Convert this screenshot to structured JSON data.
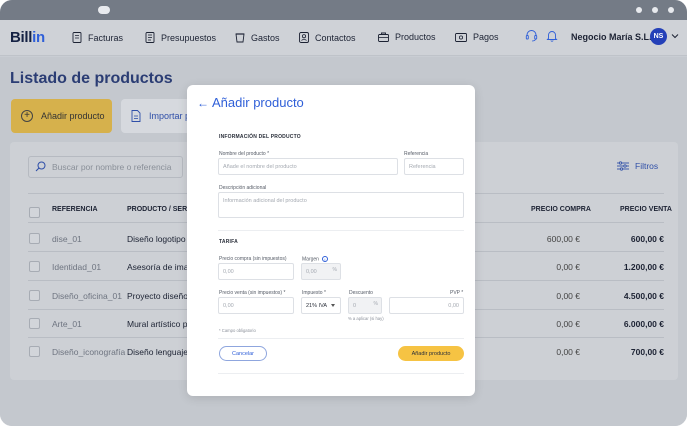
{
  "app": {
    "logo_text": "Bill",
    "logo_accent": "in",
    "brand_color": "#2f5fd8"
  },
  "nav": {
    "items": [
      {
        "label": "Facturas",
        "icon": "invoice-icon"
      },
      {
        "label": "Presupuestos",
        "icon": "quote-icon"
      },
      {
        "label": "Gastos",
        "icon": "expenses-icon"
      },
      {
        "label": "Contactos",
        "icon": "contacts-icon"
      },
      {
        "label": "Productos",
        "icon": "products-icon"
      },
      {
        "label": "Pagos",
        "icon": "payments-icon"
      }
    ],
    "company": "Negocio María S.L.",
    "avatar_initials": "NS"
  },
  "page": {
    "title": "Listado de productos",
    "add_button": "Añadir producto",
    "import_button": "Importar p",
    "search_placeholder": "Buscar por nombre o referencia",
    "filters_label": "Filtros"
  },
  "table": {
    "headers": {
      "reference": "REFERENCIA",
      "product": "PRODUCTO / SERVIC",
      "purchase_price": "PRECIO COMPRA",
      "sale_price": "PRECIO VENTA"
    },
    "rows": [
      {
        "reference": "dise_01",
        "product": "Diseño logotipo",
        "purchase": "600,00 €",
        "sale": "600,00 €"
      },
      {
        "reference": "Identidad_01",
        "product": "Asesoría de imag",
        "purchase": "0,00 €",
        "sale": "1.200,00 €"
      },
      {
        "reference": "Diseño_oficina_01",
        "product": "Proyecto diseño",
        "purchase": "0,00 €",
        "sale": "4.500,00 €"
      },
      {
        "reference": "Arte_01",
        "product": "Mural artístico pe",
        "purchase": "0,00 €",
        "sale": "6.000,00 €"
      },
      {
        "reference": "Diseño_iconografía",
        "product": "Diseño lenguaje i",
        "purchase": "0,00 €",
        "sale": "700,00 €"
      }
    ]
  },
  "modal": {
    "title": "Añadir producto",
    "section_product": "INFORMACIÓN DEL PRODUCTO",
    "name_label": "Nombre del producto *",
    "name_placeholder": "Añade el nombre del producto",
    "ref_label": "Referencia",
    "ref_placeholder": "Referencia",
    "desc_label": "Descripción adicional",
    "desc_placeholder": "Información adicional del producto",
    "section_price": "TARIFA",
    "purchase_label": "Precio compra (sin impuestos)",
    "purchase_value": "0,00",
    "margin_label": "Margen",
    "margin_value": "0,00",
    "margin_unit": "%",
    "sale_label": "Precio venta (sin impuestos) *",
    "sale_value": "0,00",
    "tax_label": "Impuesto *",
    "tax_value": "21% IVA",
    "discount_label": "Descuento",
    "discount_value": "0",
    "discount_unit": "%",
    "discount_hint": "% a aplicar (si hay)",
    "pvp_label": "PVP *",
    "pvp_value": "0,00",
    "required_note": "* Campo obligatorio",
    "cancel": "Cancelar",
    "submit": "Añadir producto"
  }
}
